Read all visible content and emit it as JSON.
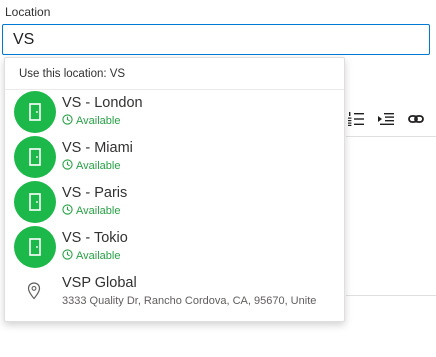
{
  "location_field": {
    "label": "Location",
    "value": "VS"
  },
  "dropdown": {
    "use_location_label": "Use this location: VS",
    "rooms": [
      {
        "name": "VS - London",
        "status": "Available",
        "icon": "door-icon"
      },
      {
        "name": "VS - Miami",
        "status": "Available",
        "icon": "door-icon"
      },
      {
        "name": "VS - Paris",
        "status": "Available",
        "icon": "door-icon"
      },
      {
        "name": "VS - Tokio",
        "status": "Available",
        "icon": "door-icon"
      }
    ],
    "place": {
      "name": "VSP Global",
      "address": "3333 Quality Dr, Rancho Cordova, CA, 95670, Unite",
      "icon": "map-pin-icon"
    }
  },
  "toolbar": {
    "icons": [
      "numbered-list-icon",
      "decrease-indent-icon",
      "link-icon"
    ]
  },
  "colors": {
    "accent": "#0078d4",
    "available_green": "#1db84a",
    "status_text": "#29a047"
  }
}
